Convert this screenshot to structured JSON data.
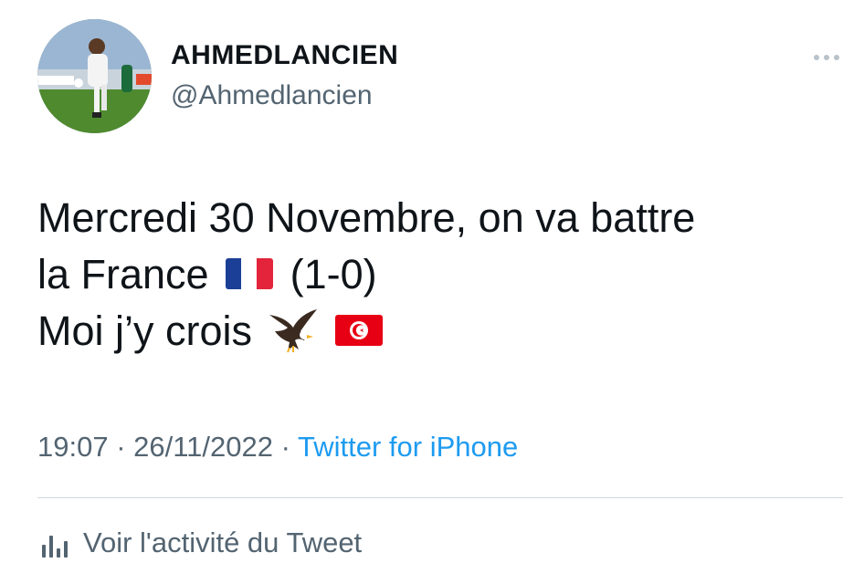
{
  "author": {
    "display_name": "AHMEDLANCIEN",
    "handle": "@Ahmedlancien",
    "avatar_icon": "profile-photo-football-player"
  },
  "more_icon": "ellipsis-horizontal-icon",
  "tweet": {
    "lines": [
      {
        "text": "Mercredi 30 Novembre, on va battre"
      },
      {
        "text_before": "la France",
        "flag_icon": "flag-france-icon",
        "text_after": "(1-0)"
      },
      {
        "text": "Moi j’y crois",
        "icons": [
          "eagle-icon",
          "flag-tunisia-icon"
        ]
      }
    ]
  },
  "meta": {
    "time": "19:07",
    "separator": " · ",
    "date": "26/11/2022",
    "source": "Twitter for iPhone"
  },
  "analytics": {
    "icon": "bar-chart-icon",
    "label": "Voir l'activité du Tweet"
  },
  "colors": {
    "text": "#0f1419",
    "secondary": "#536471",
    "link": "#1d9bf0",
    "divider": "#cfd9de"
  }
}
